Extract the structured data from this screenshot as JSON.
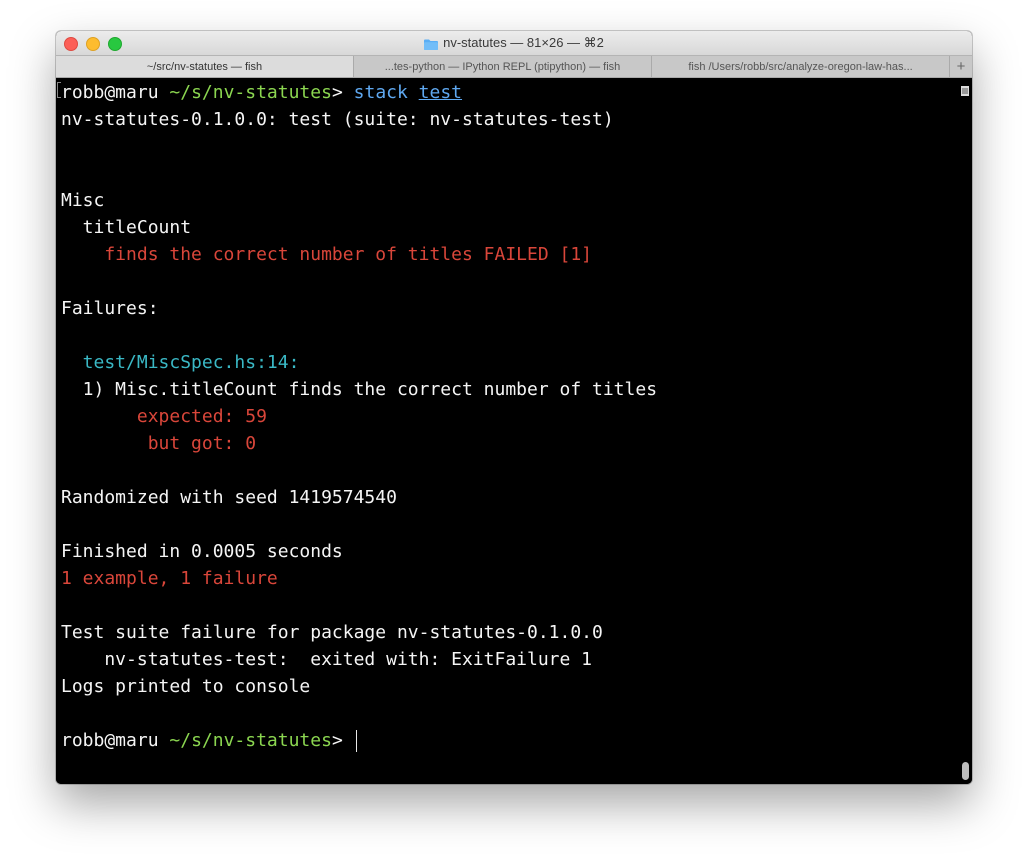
{
  "window": {
    "title": "nv-statutes — 81×26 — ⌘2"
  },
  "tabs": [
    {
      "label": "~/src/nv-statutes — fish",
      "active": true
    },
    {
      "label": "...tes-python — IPython REPL (ptipython) — fish",
      "active": false
    },
    {
      "label": "fish  /Users/robb/src/analyze-oregon-law-has...",
      "active": false
    }
  ],
  "tab_add": "+",
  "terminal": {
    "prompt_user": "robb@maru",
    "prompt_path": "~/s/nv-statutes",
    "prompt_symbol": ">",
    "cmd1": "stack",
    "cmd2": "test",
    "line_header": "nv-statutes-0.1.0.0: test (suite: nv-statutes-test)",
    "misc": "Misc",
    "titlecount": "  titleCount",
    "failed_line": "    finds the correct number of titles FAILED [1]",
    "failures": "Failures:",
    "spec_loc": "  test/MiscSpec.hs:14:",
    "failure_desc": "  1) Misc.titleCount finds the correct number of titles",
    "expected": "       expected: 59",
    "butgot": "        but got: 0",
    "seed": "Randomized with seed 1419574540",
    "finished": "Finished in 0.0005 seconds",
    "summary": "1 example, 1 failure",
    "suite_failure": "Test suite failure for package nv-statutes-0.1.0.0",
    "exited": "    nv-statutes-test:  exited with: ExitFailure 1",
    "logs": "Logs printed to console"
  },
  "colors": {
    "prompt_path": "#8bd650",
    "command": "#5fa8f0",
    "error": "#d9463a",
    "location": "#3ab8c5"
  }
}
